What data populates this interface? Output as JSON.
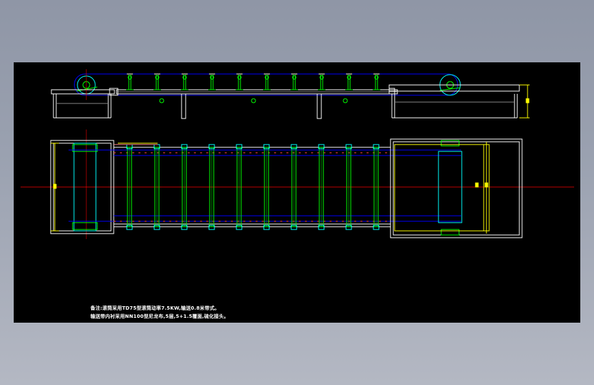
{
  "notes": [
    "备注:滚筒采用TD75型滚筒动率7.5KW,输送0.8米带式。",
    "输送带内衬采用NN100型尼龙布,5层,5+1.5覆面,硫化接头。"
  ],
  "colors": {
    "background_top": "#8f96a6",
    "background_bottom": "#b4b8c3",
    "canvas": "#000000",
    "frame": "#ffffff",
    "belt": "#0000ff",
    "idler": "#00ff00",
    "centerline": "#ff0000",
    "base": "#00ffff",
    "dimension": "#ffff00",
    "note_text": "#ffffff"
  }
}
